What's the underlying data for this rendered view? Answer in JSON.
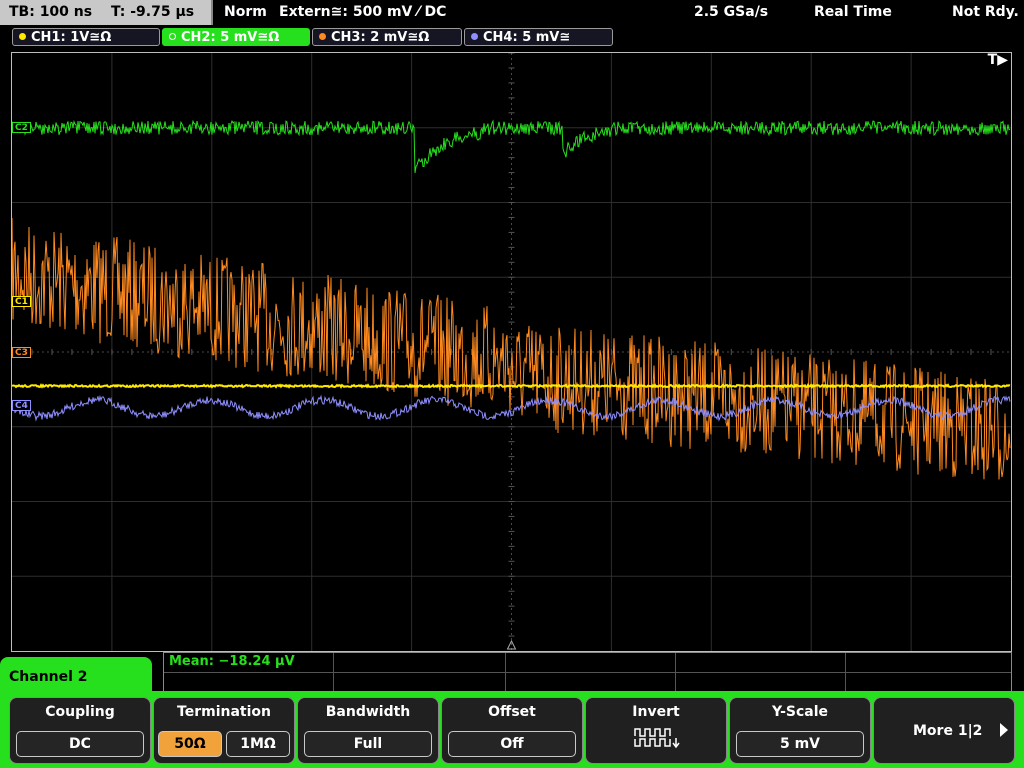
{
  "status": {
    "timebase": "TB: 100 ns",
    "trigger_time": "T: -9.75 µs",
    "mode": "Norm",
    "trigger_source": "Extern≅: 500 mV ⁄ DC",
    "sample_rate": "2.5 GSa/s",
    "acquisition": "Real Time",
    "state": "Not Rdy."
  },
  "channels": [
    {
      "label": "CH1: 1V≅Ω",
      "color": "#ffea00"
    },
    {
      "label": "CH2: 5 mV≅Ω",
      "color": "#27e01d"
    },
    {
      "label": "CH3: 2 mV≅Ω",
      "color": "#ff8a1f"
    },
    {
      "label": "CH4: 5 mV≅",
      "color": "#8f8fff"
    }
  ],
  "markers": {
    "c1": "C1",
    "c2": "C2",
    "c3": "C3",
    "c4": "C4",
    "trigger": "T▶"
  },
  "measurement": {
    "label": "Mean: −18.24 µV"
  },
  "menu": {
    "title": "Channel 2",
    "coupling": {
      "title": "Coupling",
      "value": "DC"
    },
    "termination": {
      "title": "Termination",
      "opt1": "50Ω",
      "opt2": "1MΩ",
      "selected": "50Ω"
    },
    "bandwidth": {
      "title": "Bandwidth",
      "value": "Full"
    },
    "offset": {
      "title": "Offset",
      "value": "Off"
    },
    "invert": {
      "title": "Invert",
      "icon": "invert-waveform-icon"
    },
    "yscale": {
      "title": "Y-Scale",
      "value": "5 mV"
    },
    "more": {
      "label": "More 1|2"
    }
  },
  "colors": {
    "accent_green": "#27e01d",
    "selected_orange": "#f2a23a"
  }
}
